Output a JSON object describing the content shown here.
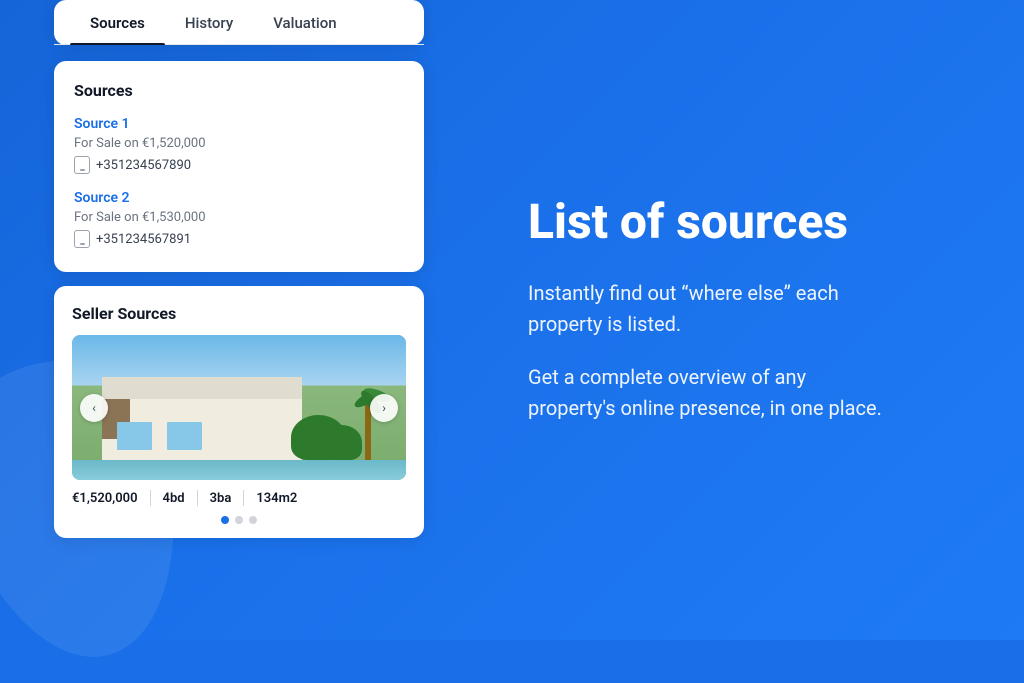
{
  "tabs": {
    "items": [
      {
        "label": "Sources",
        "active": true
      },
      {
        "label": "History",
        "active": false
      },
      {
        "label": "Valuation",
        "active": false
      }
    ]
  },
  "sources_card": {
    "title": "Sources",
    "source1": {
      "name": "Source 1",
      "listing": "For Sale on €1,520,000",
      "phone": "+351234567890"
    },
    "source2": {
      "name": "Source 2",
      "listing": "For Sale on €1,530,000",
      "phone": "+351234567891"
    }
  },
  "seller_card": {
    "title": "Seller Sources",
    "price": "€1,520,000",
    "beds": "4bd",
    "baths": "3ba",
    "area": "134m2"
  },
  "right_panel": {
    "title": "List of sources",
    "desc1": "Instantly find out “where else” each property is listed.",
    "desc2": "Get a complete overview of any property's online presence, in one place."
  },
  "dots": [
    {
      "active": true
    },
    {
      "active": false
    },
    {
      "active": false
    }
  ]
}
